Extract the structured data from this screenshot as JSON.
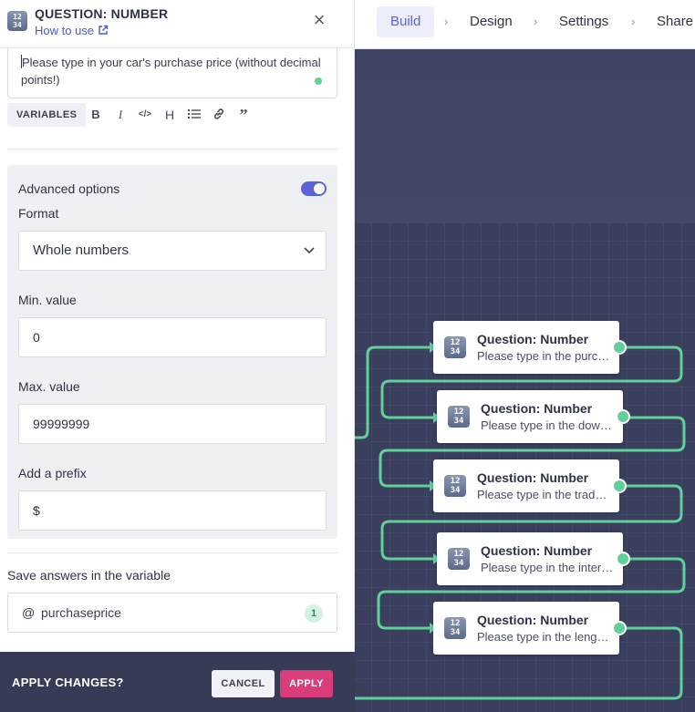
{
  "nav": {
    "steps": [
      "Build",
      "Design",
      "Settings",
      "Share"
    ],
    "active_step": "Build",
    "separator": "›"
  },
  "panel": {
    "title": "QUESTION: NUMBER",
    "icon_text": "1234",
    "how_to_label": "How to use",
    "close_icon": "×",
    "question_text": "Please type in your car's purchase price (without decimal points!)",
    "toolbar": {
      "variables_label": "VARIABLES",
      "buttons": [
        "B",
        "I",
        "</>",
        "H",
        "list",
        "link",
        "quote"
      ]
    },
    "advanced": {
      "label": "Advanced options",
      "enabled": true,
      "format_label": "Format",
      "format_value": "Whole numbers",
      "min_label": "Min. value",
      "min_value": "0",
      "max_label": "Max. value",
      "max_value": "99999999",
      "prefix_label": "Add a prefix",
      "prefix_value": "$"
    },
    "save": {
      "label": "Save answers in the variable",
      "at": "@",
      "variable": "purchaseprice",
      "badge": "1"
    }
  },
  "bottom": {
    "question": "APPLY CHANGES?",
    "cancel": "CANCEL",
    "apply": "APPLY"
  },
  "flow": {
    "nodes": [
      {
        "title": "Question: Number",
        "subtitle": "Please type in the purchase price"
      },
      {
        "title": "Question: Number",
        "subtitle": "Please type in the down payment"
      },
      {
        "title": "Question: Number",
        "subtitle": "Please type in the trade-in value"
      },
      {
        "title": "Question: Number",
        "subtitle": "Please type in the interest rate"
      },
      {
        "title": "Question: Number",
        "subtitle": "Please type in the length of the loan"
      }
    ]
  },
  "colors": {
    "accent": "#5b63d9",
    "connector": "#62d09a",
    "apply": "#d93d7a",
    "canvas": "#3b3f5e"
  }
}
